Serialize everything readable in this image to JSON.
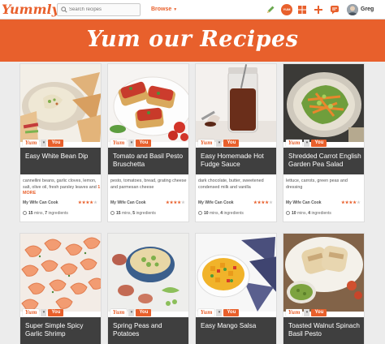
{
  "header": {
    "logo": "Yummly",
    "search_placeholder": "Search recipes",
    "browse_label": "Browse",
    "yum_badge": "YUM",
    "user_name": "Greg"
  },
  "banner": {
    "title": "Yum our Recipes"
  },
  "tags": {
    "yum": "Yum",
    "you": "You"
  },
  "colors": {
    "brand": "#e8602c",
    "title_bar": "#3f3f3f"
  },
  "recipes": [
    {
      "title": "Easy White Bean Dip",
      "ingredients": "cannellini beans, garlic cloves, lemon, salt, olive oil, fresh parsley leaves and",
      "more": "1 MORE",
      "source": "My Wife Can Cook",
      "rating": 4,
      "time": "15",
      "time_unit": "mins,",
      "ingredient_count": "7",
      "ingredient_label": "ingredients"
    },
    {
      "title": "Tomato and Basil Pesto Bruschetta",
      "ingredients": "pesto, tomatoes, bread, grating cheese and parmesan cheese",
      "more": "",
      "source": "My Wife Can Cook",
      "rating": 4,
      "time": "15",
      "time_unit": "mins,",
      "ingredient_count": "5",
      "ingredient_label": "ingredients"
    },
    {
      "title": "Easy Homemade Hot Fudge Sauce",
      "ingredients": "dark chocolate, butter, sweetened condensed milk and vanilla",
      "more": "",
      "source": "My Wife Can Cook",
      "rating": 4,
      "time": "10",
      "time_unit": "mins,",
      "ingredient_count": "4",
      "ingredient_label": "ingredients"
    },
    {
      "title": "Shredded Carrot English Garden Pea Salad",
      "ingredients": "lettuce, carrots, green peas and dressing",
      "more": "",
      "source": "My Wife Can Cook",
      "rating": 4,
      "time": "10",
      "time_unit": "mins,",
      "ingredient_count": "4",
      "ingredient_label": "ingredients"
    },
    {
      "title": "Super Simple Spicy Garlic Shrimp"
    },
    {
      "title": "Spring Peas and Potatoes"
    },
    {
      "title": "Easy Mango Salsa"
    },
    {
      "title": "Toasted Walnut Spinach Basil Pesto"
    }
  ]
}
